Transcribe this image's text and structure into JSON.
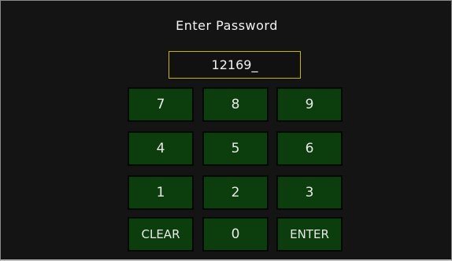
{
  "title": "Enter Password",
  "password_display": "12169_",
  "keypad": {
    "k7": "7",
    "k8": "8",
    "k9": "9",
    "k4": "4",
    "k5": "5",
    "k6": "6",
    "k1": "1",
    "k2": "2",
    "k3": "3",
    "clear": "CLEAR",
    "k0": "0",
    "enter": "ENTER"
  },
  "colors": {
    "background": "#141414",
    "key_fill": "#0c3d0c",
    "field_border": "#c8b400",
    "text": "#f2f2f2"
  }
}
